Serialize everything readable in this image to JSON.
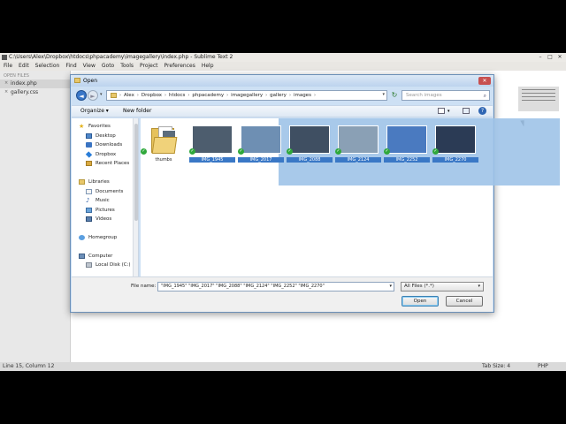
{
  "window": {
    "title": "C:\\Users\\Alex\\Dropbox\\htdocs\\phpacademy\\imagegallery\\index.php - Sublime Text 2",
    "controls": [
      "–",
      "□",
      "✕"
    ]
  },
  "menu": [
    "File",
    "Edit",
    "Selection",
    "Find",
    "View",
    "Goto",
    "Tools",
    "Project",
    "Preferences",
    "Help"
  ],
  "sidebar": {
    "header": "OPEN FILES",
    "files": [
      {
        "name": "index.php",
        "selected": true
      },
      {
        "name": "gallery.css",
        "selected": false
      }
    ]
  },
  "statusbar": {
    "position": "Line 15, Column 12",
    "tab_size": "Tab Size: 4",
    "syntax": "PHP"
  },
  "dialog": {
    "title": "Open",
    "close_glyph": "✕",
    "back_glyph": "◄",
    "forward_glyph": "►",
    "refresh_glyph": "↻",
    "breadcrumb": [
      "Alex",
      "Dropbox",
      "htdocs",
      "phpacademy",
      "imagegallery",
      "gallery",
      "images"
    ],
    "search_placeholder": "Search images",
    "organize": "Organize ▾",
    "new_folder": "New folder",
    "help_glyph": "?",
    "nav": {
      "favorites": "Favorites",
      "desktop": "Desktop",
      "downloads": "Downloads",
      "dropbox": "Dropbox",
      "recent": "Recent Places",
      "libraries": "Libraries",
      "documents": "Documents",
      "music": "Music",
      "pictures": "Pictures",
      "videos": "Videos",
      "homegroup": "Homegroup",
      "computer": "Computer",
      "local_disk": "Local Disk (C:)"
    },
    "files": [
      {
        "name": "thumbs",
        "type": "folder"
      },
      {
        "name": "IMG_1945",
        "type": "image",
        "color": "#4d5d6e"
      },
      {
        "name": "IMG_2017",
        "type": "image",
        "color": "#6e8fb3"
      },
      {
        "name": "IMG_2088",
        "type": "image",
        "color": "#3f4f62"
      },
      {
        "name": "IMG_2124",
        "type": "image",
        "color": "#8aa0b5"
      },
      {
        "name": "IMG_2252",
        "type": "image",
        "color": "#4a7ac0"
      },
      {
        "name": "IMG_2270",
        "type": "image",
        "color": "#2b3b55"
      }
    ],
    "file_name_label": "File name:",
    "file_name_value": "\"IMG_1945\" \"IMG_2017\" \"IMG_2088\" \"IMG_2124\" \"IMG_2252\" \"IMG_2270\"",
    "file_type": "All Files (*.*)",
    "open_label": "Open",
    "cancel_label": "Cancel"
  },
  "colors": {
    "selection": "#9ec3e8",
    "dialog_frame": "#cde0f4",
    "accent": "#3a77c8"
  }
}
